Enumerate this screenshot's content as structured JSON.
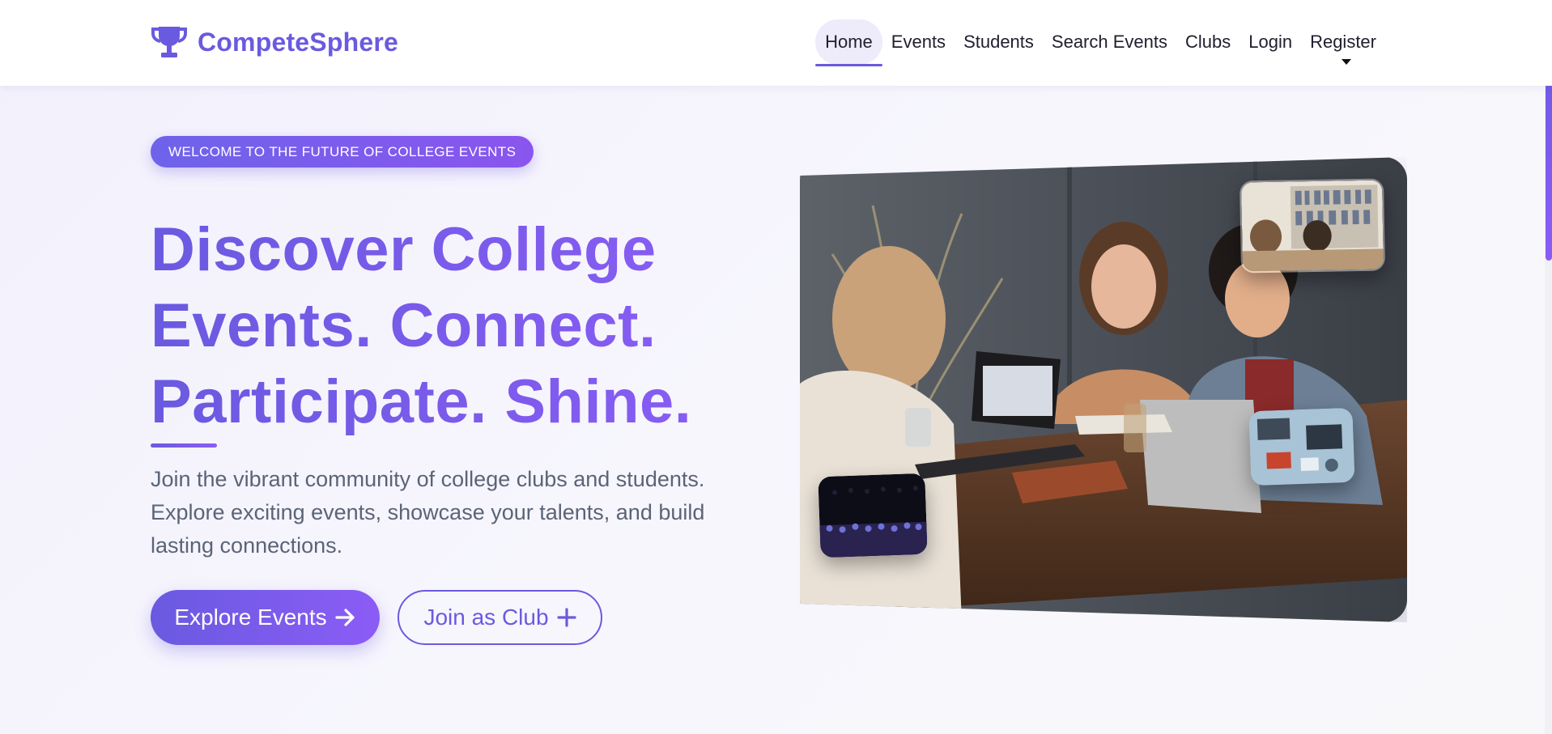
{
  "brand": {
    "name": "CompeteSphere",
    "icon": "trophy-icon",
    "color": "#6a5ae0"
  },
  "nav": {
    "items": [
      {
        "label": "Home",
        "active": true
      },
      {
        "label": "Events",
        "active": false
      },
      {
        "label": "Students",
        "active": false
      },
      {
        "label": "Search Events",
        "active": false
      },
      {
        "label": "Clubs",
        "active": false
      },
      {
        "label": "Login",
        "active": false
      },
      {
        "label": "Register",
        "active": false,
        "dropdown": true
      }
    ]
  },
  "hero": {
    "badge": "WELCOME TO THE FUTURE OF COLLEGE EVENTS",
    "headline_lines": [
      "Discover College",
      "Events. Connect.",
      "Participate. Shine."
    ],
    "lead": "Join the vibrant community of college clubs and students. Explore exciting events, showcase your talents, and build lasting connections.",
    "primary_button": {
      "label": "Explore Events",
      "icon": "arrow-right-icon"
    },
    "secondary_button": {
      "label": "Join as Club",
      "icon": "plus-icon"
    }
  },
  "colors": {
    "accent": "#6a5ae0",
    "accent_secondary": "#8b5cf6",
    "body_text": "#5b6477"
  }
}
